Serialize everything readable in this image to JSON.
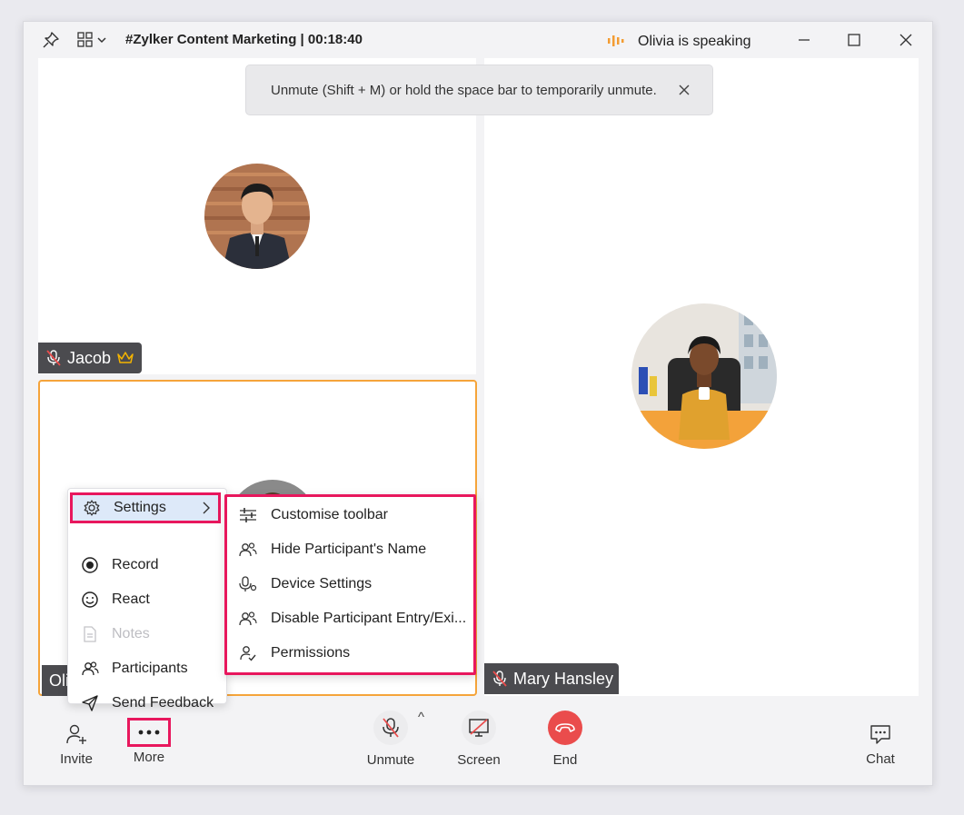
{
  "titlebar": {
    "meeting_title": "#Zylker Content Marketing | 00:18:40",
    "speaking_status": "Olivia is speaking"
  },
  "toast": {
    "message": "Unmute (Shift + M) or hold the space bar to temporarily unmute."
  },
  "participants": {
    "jacob": {
      "name": "Jacob",
      "is_host": true
    },
    "olivia": {
      "name": "Olivia",
      "name_visible": "Oli"
    },
    "mary": {
      "name": "Mary Hansley"
    }
  },
  "more_menu": {
    "items": [
      {
        "label": "Settings",
        "icon": "gear-icon",
        "enabled": true,
        "has_submenu": true
      },
      {
        "label": "Record",
        "icon": "record-icon",
        "enabled": true
      },
      {
        "label": "React",
        "icon": "smiley-icon",
        "enabled": true
      },
      {
        "label": "Notes",
        "icon": "notes-icon",
        "enabled": false
      },
      {
        "label": "Participants",
        "icon": "participants-icon",
        "enabled": true
      },
      {
        "label": "Send Feedback",
        "icon": "send-icon",
        "enabled": true
      }
    ]
  },
  "settings_submenu": {
    "items": [
      {
        "label": "Customise toolbar",
        "icon": "sliders-icon"
      },
      {
        "label": "Hide Participant's Name",
        "icon": "people-icon"
      },
      {
        "label": "Device Settings",
        "icon": "mic-settings-icon"
      },
      {
        "label": "Disable Participant Entry/Exi...",
        "icon": "people-icon"
      },
      {
        "label": "Permissions",
        "icon": "user-check-icon"
      }
    ]
  },
  "toolbar": {
    "invite_label": "Invite",
    "more_label": "More",
    "unmute_label": "Unmute",
    "screen_label": "Screen",
    "end_label": "End",
    "chat_label": "Chat"
  },
  "colors": {
    "highlight": "#e8175d",
    "end_red": "#ea4c4c",
    "active_border": "#f5a43a",
    "speaking_orange": "#f39c33"
  }
}
